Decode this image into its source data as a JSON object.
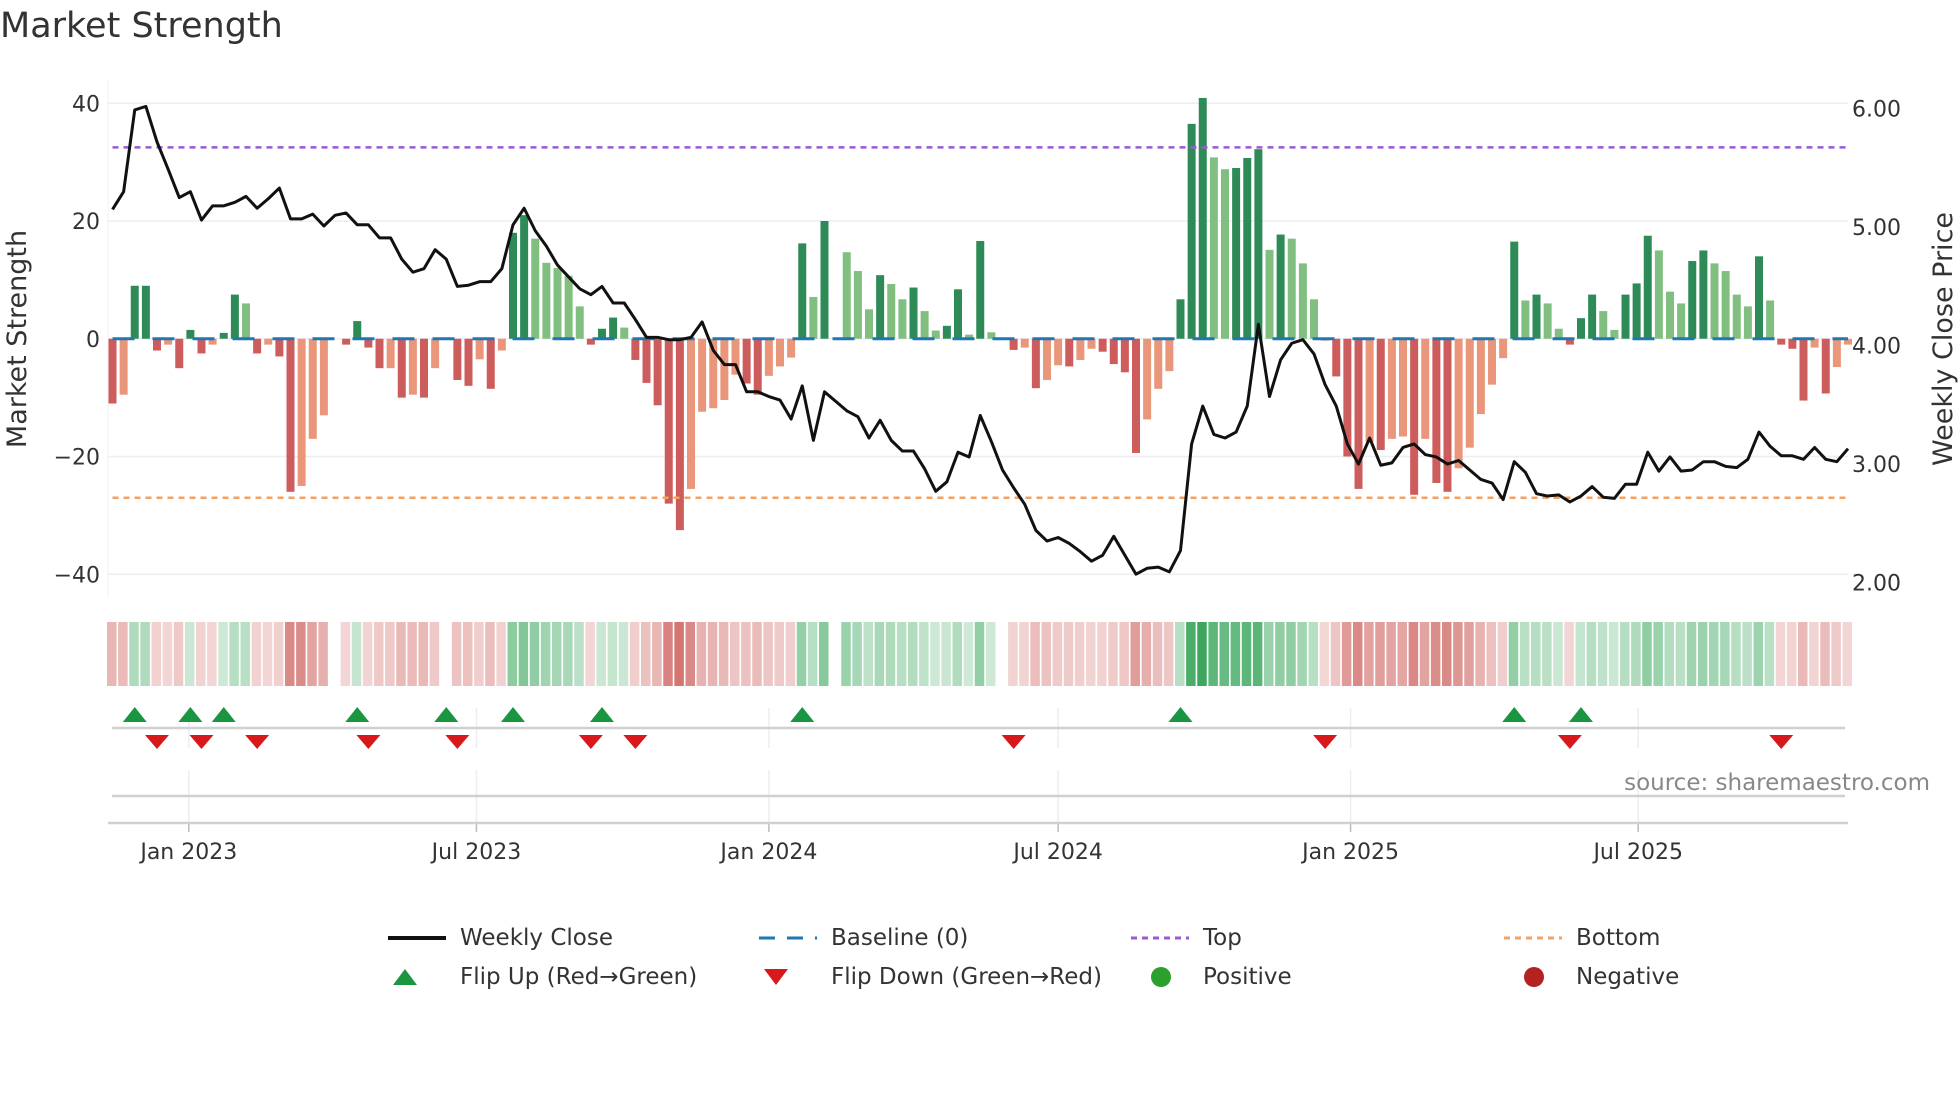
{
  "chart_data": {
    "type": "bar",
    "title": "Market Strength",
    "start_date": "2022-11-14",
    "week_days": 7,
    "left_axis": {
      "label": "Market Strength",
      "range": [
        -44,
        42
      ],
      "ticks": [
        40,
        20,
        0,
        -20,
        -40
      ],
      "tick_labels": [
        "40",
        "20",
        "0",
        "−20",
        "−40"
      ]
    },
    "right_axis": {
      "label": "Weekly Close Price",
      "range": [
        1.78,
        6.2
      ],
      "ticks": [
        6,
        5,
        4,
        3,
        2
      ],
      "tick_labels": [
        "6.00",
        "5.00",
        "4.00",
        "3.00",
        "2.00"
      ]
    },
    "x_ticks": [
      {
        "date": "2023-01-01",
        "label": "Jan 2023"
      },
      {
        "date": "2023-07-01",
        "label": "Jul 2023"
      },
      {
        "date": "2024-01-01",
        "label": "Jan 2024"
      },
      {
        "date": "2024-07-01",
        "label": "Jul 2024"
      },
      {
        "date": "2025-01-01",
        "label": "Jan 2025"
      },
      {
        "date": "2025-07-01",
        "label": "Jul 2025"
      }
    ],
    "top_level": 32.5,
    "bottom_level": -27,
    "baseline": 0,
    "strength": [
      -11,
      -9.5,
      9,
      9,
      -2,
      -1,
      -5,
      1.5,
      -2.5,
      -1,
      1,
      7.5,
      6,
      -2.5,
      -1,
      -3,
      -26,
      -25,
      -17,
      -13,
      0,
      -1,
      3,
      -1.5,
      -5,
      -5,
      -10,
      -9.5,
      -10,
      -5,
      0,
      -7,
      -8,
      -3.5,
      -8.5,
      -2,
      18,
      21,
      17,
      12.9,
      12,
      10.7,
      5.5,
      -1,
      1.7,
      3.6,
      1.9,
      -3.6,
      -7.5,
      -11.3,
      -28,
      -32.5,
      -25.5,
      -12.4,
      -11.8,
      -10.4,
      -6.1,
      -7.6,
      -9.5,
      -6.3,
      -4.7,
      -3.2,
      16.2,
      7.1,
      20,
      0,
      14.7,
      11.5,
      5,
      10.8,
      9.3,
      6.7,
      8.7,
      4.7,
      1.4,
      2.2,
      8.4,
      0.7,
      16.6,
      1.1,
      0,
      -1.9,
      -1.5,
      -8.4,
      -7,
      -4.5,
      -4.7,
      -3.6,
      -1.7,
      -2.2,
      -4.3,
      -5.7,
      -19.4,
      -13.7,
      -8.5,
      -5.5,
      6.7,
      36.5,
      40.9,
      30.8,
      28.8,
      29,
      30.7,
      32.2,
      15.1,
      17.7,
      17,
      12.8,
      6.7,
      -0.3,
      -6.4,
      -20,
      -25.5,
      -17.5,
      -18.9,
      -17,
      -16.6,
      -26.5,
      -17,
      -24.5,
      -26,
      -22,
      -18.5,
      -12.8,
      -7.8,
      -3.3,
      16.5,
      6.5,
      7.5,
      6,
      1.7,
      -1,
      3.5,
      7.5,
      4.7,
      1.5,
      7.5,
      9.4,
      17.5,
      15,
      8,
      6,
      13.2,
      15,
      12.8,
      11.5,
      7.5,
      5.5,
      14,
      6.5,
      -1,
      -1.7,
      -10.5,
      -1.5,
      -9.3,
      -4.8,
      -1
    ],
    "momentum": "RrGGRrRGRrGGgRrRRrrrRRGRRrRrRrRRRrRrGGgggggRGGgRRRRRrrrrrRRrrrGgGGgggGggGggGGgGgRRrRrrRrrRRRRrrrGGGggGGGgGgggRRRRrRrrRrRRrrrrrGgGggRGGggGGGgggGGggggGgRRRrRrr",
    "close": [
      5.15,
      5.3,
      5.99,
      6.02,
      5.72,
      5.49,
      5.25,
      5.3,
      5.06,
      5.18,
      5.18,
      5.21,
      5.26,
      5.16,
      5.24,
      5.33,
      5.07,
      5.07,
      5.11,
      5.01,
      5.1,
      5.12,
      5.02,
      5.02,
      4.91,
      4.91,
      4.73,
      4.62,
      4.65,
      4.81,
      4.73,
      4.5,
      4.51,
      4.54,
      4.54,
      4.65,
      5.02,
      5.16,
      4.97,
      4.84,
      4.68,
      4.58,
      4.48,
      4.43,
      4.5,
      4.36,
      4.36,
      4.22,
      4.07,
      4.07,
      4.05,
      4.05,
      4.07,
      4.2,
      3.96,
      3.84,
      3.84,
      3.61,
      3.61,
      3.57,
      3.54,
      3.38,
      3.66,
      3.2,
      3.61,
      3.53,
      3.45,
      3.4,
      3.22,
      3.37,
      3.2,
      3.11,
      3.11,
      2.96,
      2.77,
      2.85,
      3.1,
      3.06,
      3.41,
      3.19,
      2.95,
      2.8,
      2.66,
      2.44,
      2.35,
      2.38,
      2.33,
      2.26,
      2.18,
      2.23,
      2.39,
      2.23,
      2.07,
      2.12,
      2.13,
      2.09,
      2.27,
      3.17,
      3.49,
      3.25,
      3.22,
      3.27,
      3.49,
      4.18,
      3.57,
      3.88,
      4.02,
      4.05,
      3.93,
      3.67,
      3.49,
      3.17,
      3.0,
      3.22,
      2.99,
      3.01,
      3.14,
      3.17,
      3.08,
      3.06,
      3.0,
      3.03,
      2.95,
      2.87,
      2.84,
      2.7,
      3.02,
      2.93,
      2.75,
      2.73,
      2.74,
      2.68,
      2.73,
      2.81,
      2.72,
      2.71,
      2.83,
      2.83,
      3.1,
      2.94,
      3.06,
      2.94,
      2.95,
      3.02,
      3.02,
      2.98,
      2.97,
      3.04,
      3.27,
      3.15,
      3.07,
      3.07,
      3.04,
      3.14,
      3.04,
      3.02,
      3.13
    ],
    "flips_up_weeks": [
      2,
      7,
      10,
      22,
      30,
      36,
      44,
      62,
      96,
      126,
      132
    ],
    "flips_down_weeks": [
      4,
      8,
      13,
      23,
      31,
      43,
      47,
      81,
      109,
      131,
      150
    ],
    "colors": {
      "rising_positive": "#2e8b57",
      "falling_positive": "#80bf80",
      "falling_negative": "#cd5c5c",
      "rising_negative": "#e9967a",
      "close": "#111111",
      "baseline": "#1f77b4",
      "top": "#9b59d6",
      "bottom": "#f4a261",
      "flip_up": "#1a9641",
      "flip_down": "#d7191c",
      "positive": "#2ca02c",
      "negative": "#b22222"
    },
    "legend": [
      {
        "key": "close",
        "label": "Weekly Close"
      },
      {
        "key": "baseline",
        "label": "Baseline (0)"
      },
      {
        "key": "top",
        "label": "Top"
      },
      {
        "key": "bottom",
        "label": "Bottom"
      },
      {
        "key": "flip_up",
        "label": "Flip Up (Red→Green)"
      },
      {
        "key": "flip_down",
        "label": "Flip Down (Green→Red)"
      },
      {
        "key": "positive",
        "label": "Positive"
      },
      {
        "key": "negative",
        "label": "Negative"
      }
    ],
    "legend_placement": "bottom",
    "source": "source: sharemaestro.com"
  }
}
